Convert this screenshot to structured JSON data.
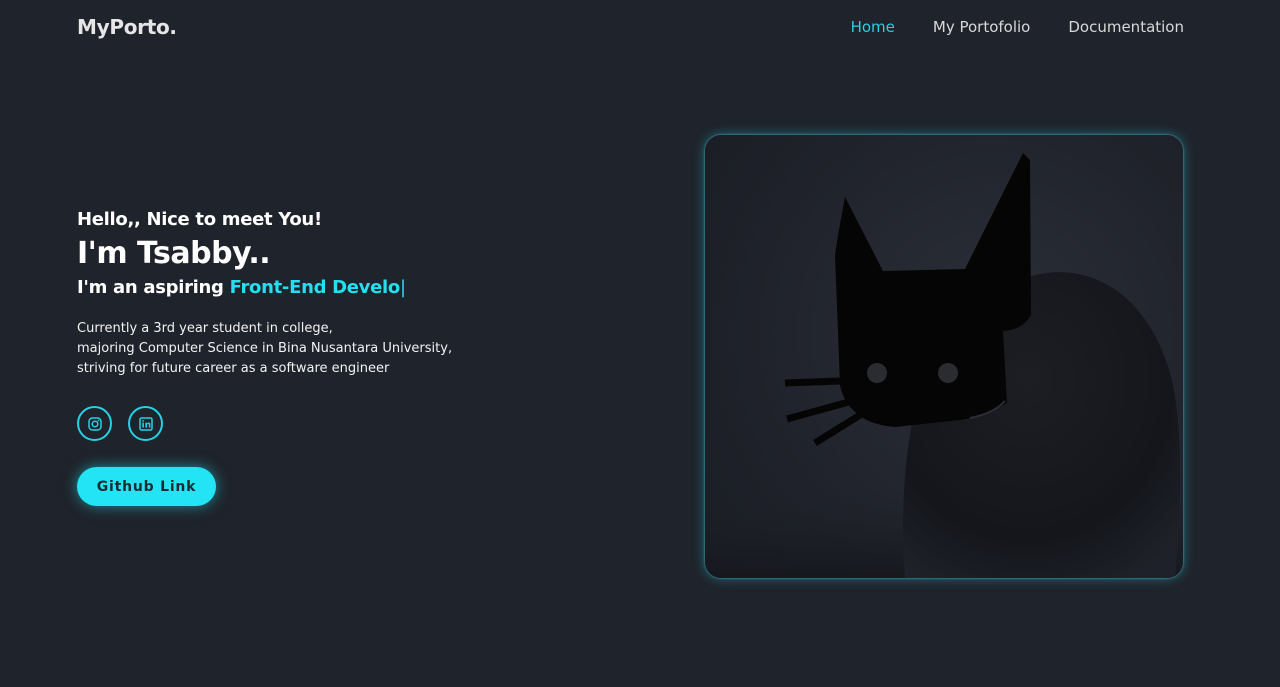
{
  "header": {
    "logo": "MyPorto.",
    "nav": [
      {
        "label": "Home",
        "active": true
      },
      {
        "label": "My Portofolio",
        "active": false
      },
      {
        "label": "Documentation",
        "active": false
      }
    ]
  },
  "hero": {
    "greeting": "Hello,, Nice to meet You!",
    "name": "I'm Tsabby..",
    "aspire_prefix": "I'm an aspiring ",
    "role_typed": "Front-End Develo",
    "cursor": "|",
    "bio": [
      "Currently a 3rd year student in college,",
      "majoring Computer Science in Bina Nusantara University,",
      "striving for future career as a software engineer"
    ],
    "socials": [
      {
        "icon": "instagram-icon"
      },
      {
        "icon": "linkedin-icon"
      }
    ],
    "github_button": "Github Link"
  },
  "colors": {
    "background": "#1f232b",
    "accent": "#22d3e6",
    "button": "#22e4f4"
  }
}
